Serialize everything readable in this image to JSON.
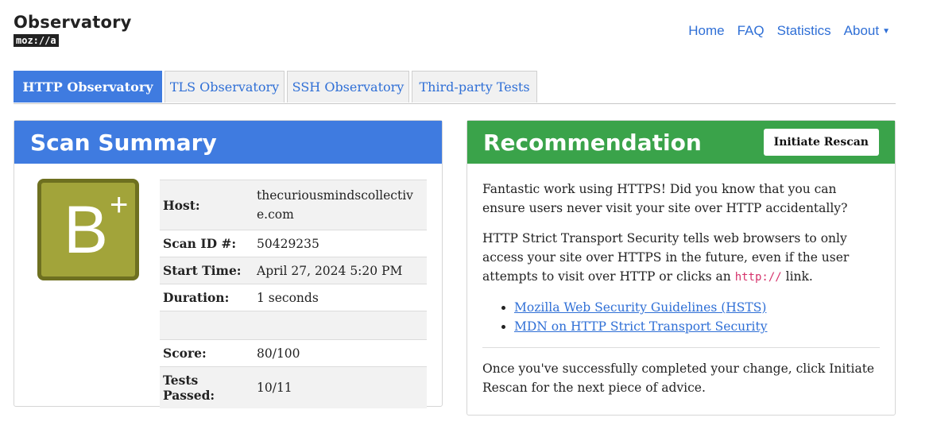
{
  "logo": {
    "title": "Observatory",
    "badge": "moz://a"
  },
  "nav": {
    "home": "Home",
    "faq": "FAQ",
    "statistics": "Statistics",
    "about": "About"
  },
  "tabs": [
    "HTTP Observatory",
    "TLS Observatory",
    "SSH Observatory",
    "Third-party Tests"
  ],
  "active_tab": "HTTP Observatory",
  "summary": {
    "title": "Scan Summary",
    "grade_letter": "B",
    "grade_modifier": "+",
    "grade_color": "#a2a43a",
    "rows": [
      {
        "label": "Host:",
        "value": "thecuriousmindscollective.com"
      },
      {
        "label": "Scan ID #:",
        "value": "50429235"
      },
      {
        "label": "Start Time:",
        "value": "April 27, 2024 5:20 PM"
      },
      {
        "label": "Duration:",
        "value": "1 seconds"
      },
      {
        "label": "",
        "value": ""
      },
      {
        "label": "Score:",
        "value": "80/100"
      },
      {
        "label": "Tests Passed:",
        "value": "10/11"
      }
    ]
  },
  "recommendation": {
    "title": "Recommendation",
    "rescan_label": "Initiate Rescan",
    "p1": "Fantastic work using HTTPS! Did you know that you can ensure users never visit your site over HTTP accidentally?",
    "p2_before": "HTTP Strict Transport Security tells web browsers to only access your site over HTTPS in the future, even if the user attempts to visit over HTTP or clicks an ",
    "p2_code": "http://",
    "p2_after": " link.",
    "links": [
      "Mozilla Web Security Guidelines (HSTS)",
      "MDN on HTTP Strict Transport Security"
    ],
    "p3": "Once you've successfully completed your change, click Initiate Rescan for the next piece of advice."
  },
  "colors": {
    "accent_blue": "#3f7be0",
    "accent_green": "#3aa34a",
    "link": "#2f6fd6"
  }
}
